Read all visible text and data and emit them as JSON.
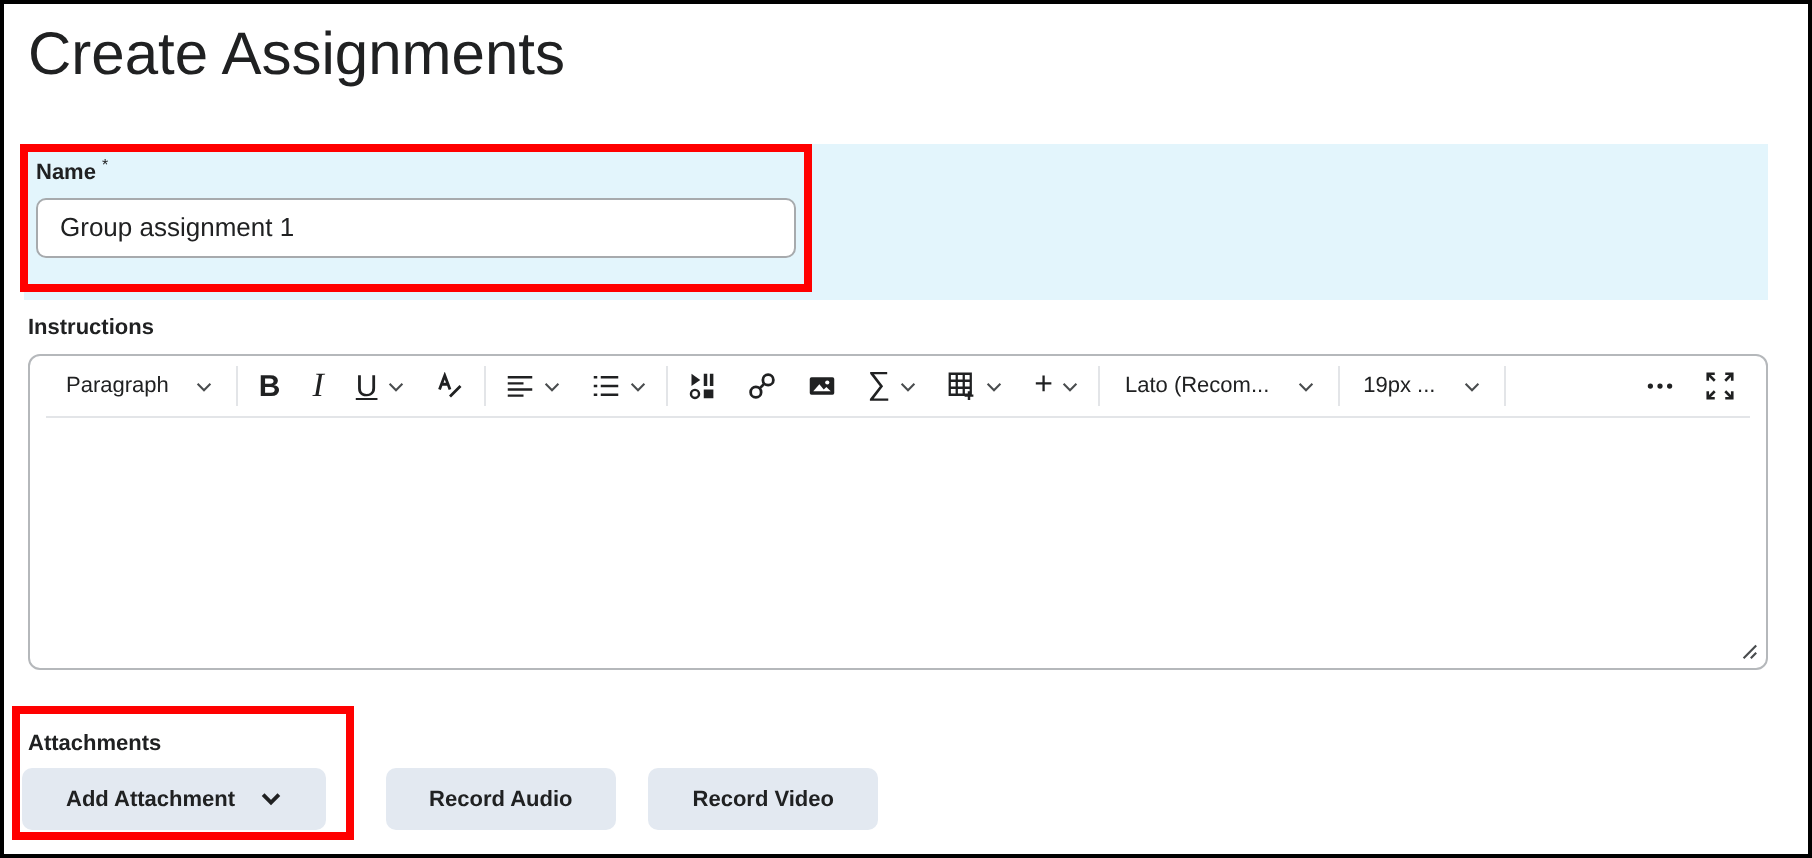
{
  "title": "Create Assignments",
  "name_field": {
    "label": "Name",
    "required_mark": "*",
    "value": "Group assignment 1",
    "highlighted": true
  },
  "instructions": {
    "label": "Instructions",
    "toolbar": [
      {
        "kind": "dropdown",
        "label": "Paragraph"
      },
      {
        "kind": "divider"
      },
      {
        "kind": "bold",
        "label": "B",
        "caret": false
      },
      {
        "kind": "italic",
        "label": "I",
        "caret": false
      },
      {
        "kind": "underline",
        "label": "U",
        "caret": true
      },
      {
        "kind": "textstyle",
        "caret": false
      },
      {
        "kind": "divider"
      },
      {
        "kind": "align",
        "caret": true
      },
      {
        "kind": "list",
        "caret": true
      },
      {
        "kind": "divider"
      },
      {
        "kind": "media",
        "caret": false
      },
      {
        "kind": "link",
        "caret": false
      },
      {
        "kind": "image",
        "caret": false
      },
      {
        "kind": "glyph",
        "label": "∑",
        "caret": true
      },
      {
        "kind": "table",
        "caret": true
      },
      {
        "kind": "glyph",
        "label": "+",
        "caret": true
      },
      {
        "kind": "divider"
      },
      {
        "kind": "dropdown",
        "label": "Lato (Recom..."
      },
      {
        "kind": "divider"
      },
      {
        "kind": "dropdown",
        "label": "19px ..."
      },
      {
        "kind": "divider"
      },
      {
        "kind": "spacer"
      },
      {
        "kind": "more",
        "caret": false
      },
      {
        "kind": "fullscreen",
        "caret": false
      }
    ]
  },
  "attachments": {
    "label": "Attachments",
    "highlighted": true,
    "buttons": [
      {
        "label": "Add Attachment",
        "caret": true
      },
      {
        "label": "Record Audio",
        "caret": false
      },
      {
        "label": "Record Video",
        "caret": false
      }
    ]
  }
}
